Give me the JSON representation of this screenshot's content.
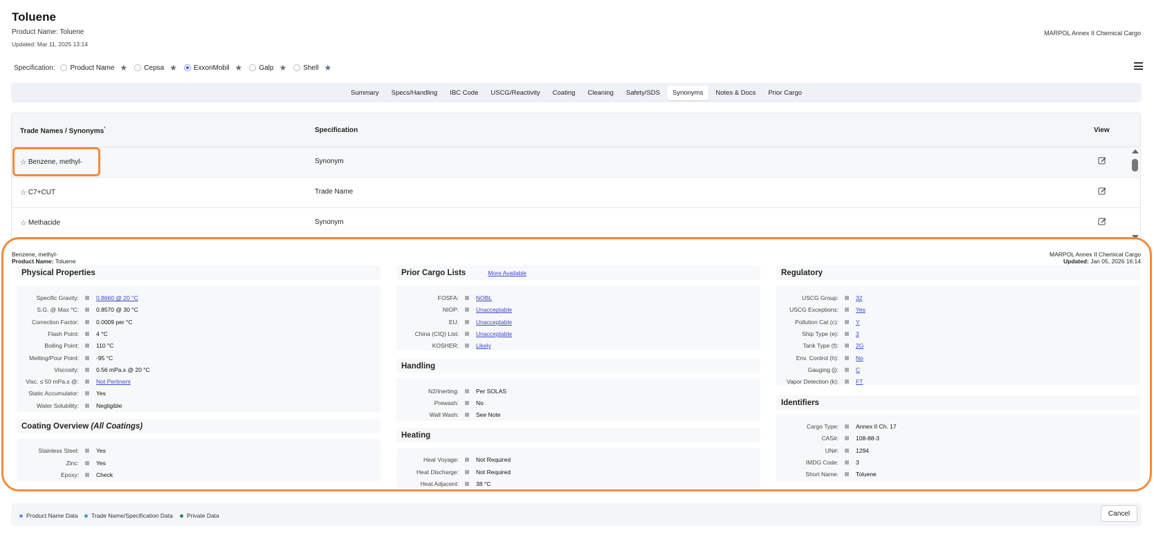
{
  "header": {
    "title": "Toluene",
    "product_name": "Product Name: Toluene",
    "updated": "Updated: Mar 11, 2025 13:14",
    "cargo_type": "MARPOL Annex II Chemical Cargo"
  },
  "specification": {
    "label": "Specification:",
    "options": [
      {
        "label": "Product Name",
        "checked": false
      },
      {
        "label": "Cepsa",
        "checked": false
      },
      {
        "label": "ExxonMobil",
        "checked": true
      },
      {
        "label": "Galp",
        "checked": false
      },
      {
        "label": "Shell",
        "checked": false
      }
    ]
  },
  "tabs": [
    "Summary",
    "Specs/Handling",
    "IBC Code",
    "USCG/Reactivity",
    "Coating",
    "Cleaning",
    "Safety/SDS",
    "Synonyms",
    "Notes & Docs",
    "Prior Cargo"
  ],
  "active_tab": "Synonyms",
  "table": {
    "headers": {
      "name": "Trade Names / Synonyms",
      "name_mark": "*",
      "spec": "Specification",
      "view": "View"
    },
    "rows": [
      {
        "name": "Benzene, methyl-",
        "spec": "Synonym"
      },
      {
        "name": "C7+CUT",
        "spec": "Trade Name"
      },
      {
        "name": "Methacide",
        "spec": "Synonym"
      }
    ]
  },
  "detail": {
    "name": "Benzene, methyl-",
    "product_name_label": "Product Name:",
    "product_name_value": "Toluene",
    "cargo_type": "MARPOL Annex II Chemical Cargo",
    "updated_label": "Updated:",
    "updated_value": "Jan 05, 2026 16:14",
    "physical": {
      "title": "Physical Properties",
      "items": [
        {
          "k": "Specific Gravity:",
          "v": "0.8660 @ 20 °C",
          "link": true
        },
        {
          "k": "S.G. @ Max °C:",
          "v": "0.8570 @ 30 °C",
          "link": false
        },
        {
          "k": "Correction Factor:",
          "v": "0.0009 per °C",
          "link": false
        },
        {
          "k": "Flash Point:",
          "v": "4 °C",
          "link": false
        },
        {
          "k": "Boiling Point:",
          "v": "110 °C",
          "link": false
        },
        {
          "k": "Melting/Pour Point:",
          "v": "-95 °C",
          "link": false
        },
        {
          "k": "Viscosity:",
          "v": "0.56 mPa.s @ 20 °C",
          "link": false
        },
        {
          "k": "Visc. ≤ 50 mPa.s @:",
          "v": "Not Pertinent",
          "link": true
        },
        {
          "k": "Static Accumulator:",
          "v": "Yes",
          "link": false
        },
        {
          "k": "Water Solubility:",
          "v": "Negligible",
          "link": false
        }
      ]
    },
    "coating": {
      "title": "Coating Overview",
      "title_italic": "(All Coatings)",
      "items": [
        {
          "k": "Stainless Steel:",
          "v": "Yes"
        },
        {
          "k": "Zinc:",
          "v": "Yes"
        },
        {
          "k": "Epoxy:",
          "v": "Check"
        }
      ]
    },
    "prior_cargo": {
      "title": "Prior Cargo Lists",
      "more": "More Available",
      "items": [
        {
          "k": "FOSFA:",
          "v": "NOBL"
        },
        {
          "k": "NIOP:",
          "v": "Unacceptable"
        },
        {
          "k": "EU:",
          "v": "Unacceptable"
        },
        {
          "k": "China (CIQ) List:",
          "v": "Unacceptable"
        },
        {
          "k": "KOSHER:",
          "v": "Likely"
        }
      ]
    },
    "handling": {
      "title": "Handling",
      "items": [
        {
          "k": "N2/Inerting:",
          "v": "Per SOLAS"
        },
        {
          "k": "Prewash:",
          "v": "No"
        },
        {
          "k": "Wall Wash:",
          "v": "See Note"
        }
      ]
    },
    "heating": {
      "title": "Heating",
      "items": [
        {
          "k": "Heat Voyage:",
          "v": "Not Required"
        },
        {
          "k": "Heat Discharge:",
          "v": "Not Required"
        },
        {
          "k": "Heat Adjacent:",
          "v": "38 °C"
        }
      ]
    },
    "regulatory": {
      "title": "Regulatory",
      "items": [
        {
          "k": "USCG Group:",
          "v": "32"
        },
        {
          "k": "USCG Exceptions:",
          "v": "Yes"
        },
        {
          "k": "Pollution Cat (c):",
          "v": "Y"
        },
        {
          "k": "Ship Type (e):",
          "v": "3"
        },
        {
          "k": "Tank Type (f):",
          "v": "2G"
        },
        {
          "k": "Env. Control (h):",
          "v": "No"
        },
        {
          "k": "Gauging (j):",
          "v": "C"
        },
        {
          "k": "Vapor Detection (k):",
          "v": "FT"
        }
      ]
    },
    "identifiers": {
      "title": "Identifiers",
      "items": [
        {
          "k": "Cargo Type:",
          "v": "Annex II Ch. 17"
        },
        {
          "k": "CAS#:",
          "v": "108-88-3"
        },
        {
          "k": "UN#:",
          "v": "1294"
        },
        {
          "k": "IMDG Code:",
          "v": "3"
        },
        {
          "k": "Short Name:",
          "v": "Toluene"
        }
      ]
    }
  },
  "legend": [
    {
      "label": "Product Name Data",
      "color": "#6b8fd6"
    },
    {
      "label": "Trade Name/Specification Data",
      "color": "#38a0d8"
    },
    {
      "label": "Private Data",
      "color": "#2e8a4a"
    }
  ],
  "cancel_label": "Cancel",
  "colors": {
    "highlight": "#f08a3c",
    "link": "#3b47c9"
  }
}
